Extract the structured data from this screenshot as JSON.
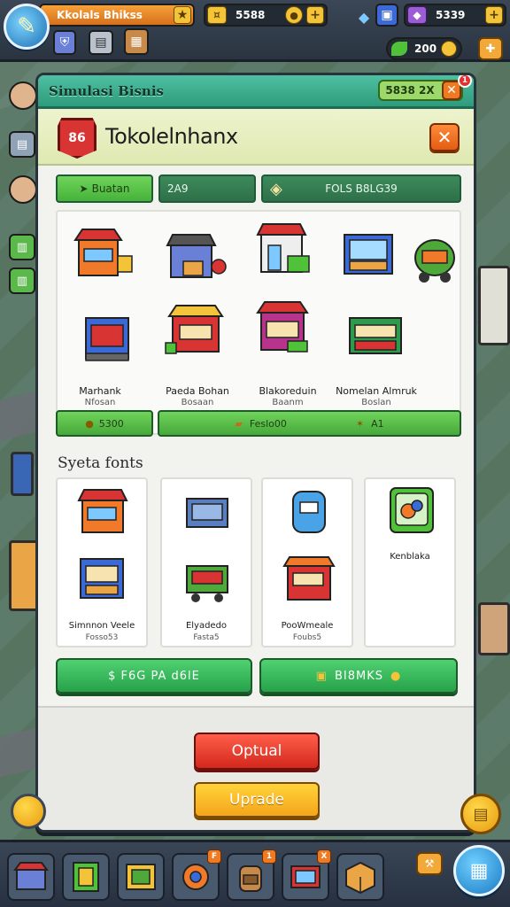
{
  "hud": {
    "level_label": "Kkolals Bhikss",
    "coins": "5588",
    "gems": "5339",
    "energy": "200",
    "icons": [
      "avatar-icon",
      "shield-icon",
      "map-icon",
      "crate-icon",
      "diamond-icon",
      "gift-icon"
    ]
  },
  "panel": {
    "title": "Simulasi Bisnis",
    "badge": "5838 2X",
    "notification_count": "1",
    "shop_name": "Tokolelnhanx",
    "shop_badge": "86"
  },
  "tabs": [
    {
      "label": "Buatan",
      "active": true
    },
    {
      "label": "2A9",
      "active": false
    },
    {
      "label": "FOLS B8LG39",
      "active": false
    }
  ],
  "shop_items": [
    {
      "label": "Marhank",
      "sub": "Nfosan"
    },
    {
      "label": "Paeda Bohan",
      "sub": "Bosaan"
    },
    {
      "label": "Blakoreduin",
      "sub": "Baanm"
    },
    {
      "label": "Nomelan Almruk",
      "sub": "Boslan"
    }
  ],
  "actions": {
    "left": "5300",
    "middle": "Feslo00",
    "right": "A1"
  },
  "section": {
    "title": "Syeta fonts",
    "cards": [
      {
        "label": "Simnnon Veele",
        "sub": "Fosso53"
      },
      {
        "label": "Elyadedo",
        "sub": "Fasta5"
      },
      {
        "label": "PooWmeale",
        "sub": "Foubs5"
      },
      {
        "label": "Kenblaka",
        "sub": ""
      }
    ]
  },
  "buttons": {
    "left_green": "$ F6G PA d6lE",
    "right_green": "BI8MKS",
    "option": "Optual",
    "upgrade": "Uprade"
  },
  "dock": {
    "slots": [
      "shop-icon",
      "book-icon",
      "card-icon",
      "cart-icon",
      "backpack-icon",
      "tv-icon",
      "box-icon"
    ],
    "badges": [
      "",
      "",
      "",
      "F",
      "1",
      "X",
      ""
    ]
  },
  "colors": {
    "title_green": "#2e9b7c",
    "action_green": "#46b23a",
    "option_red": "#d3281d",
    "upgrade_yellow": "#f5a51a",
    "hud_dark": "#2a3441"
  }
}
